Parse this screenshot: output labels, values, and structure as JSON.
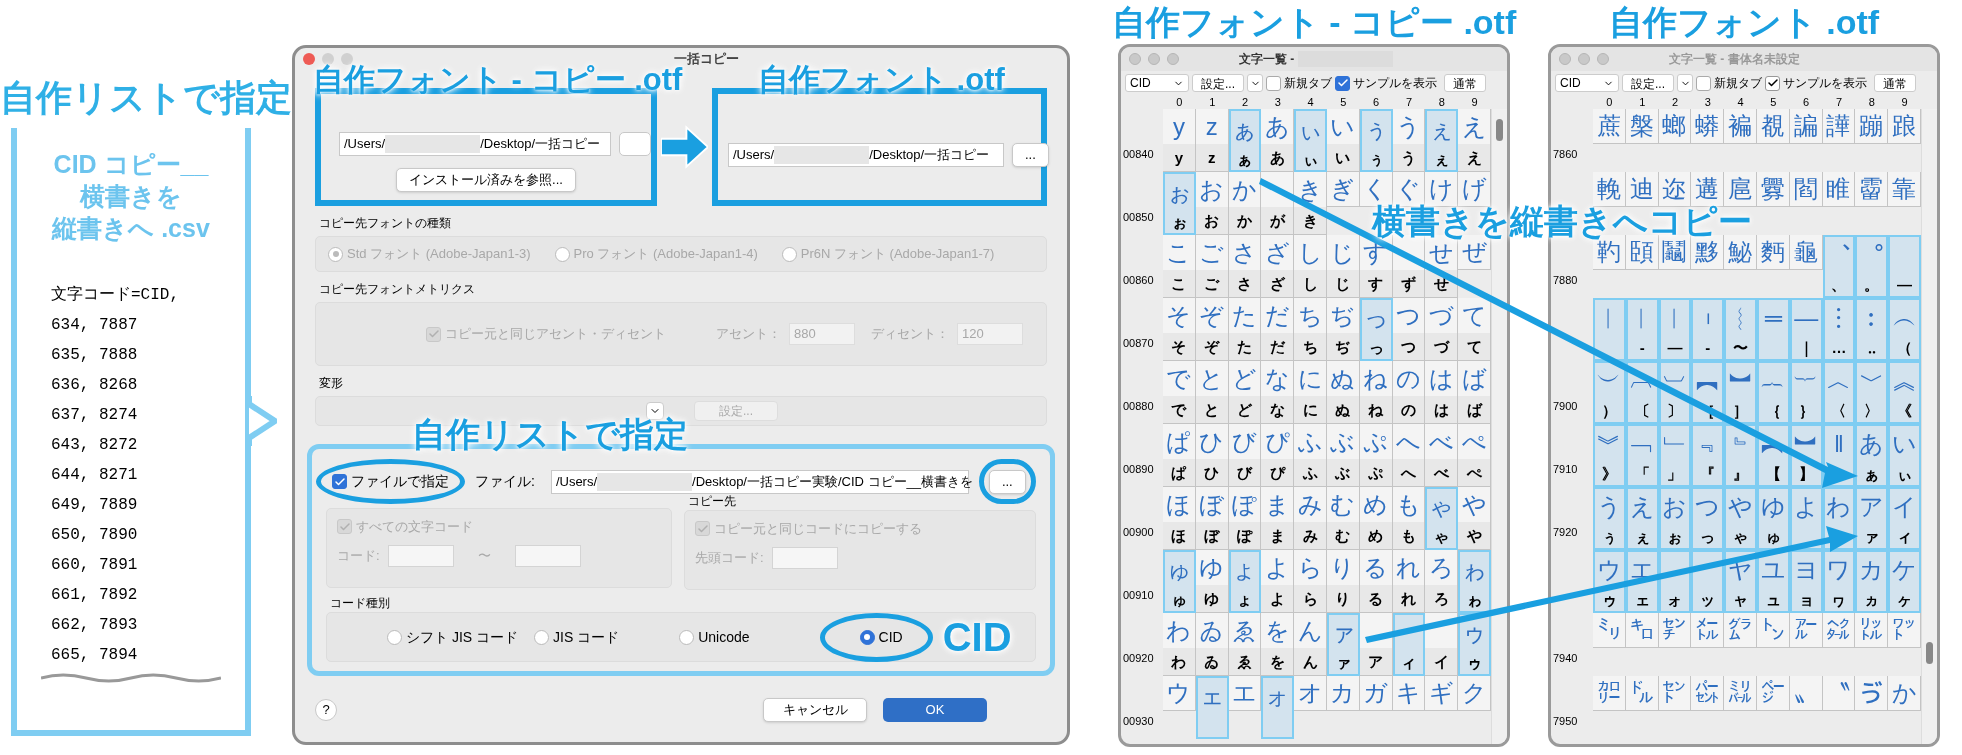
{
  "callout": {
    "title": "自作リストで指定",
    "file_name": [
      "CID コピー__",
      "横書きを",
      "縦書きへ .csv"
    ],
    "lines": [
      "文字コード=CID,",
      "634, 7887",
      "635, 7888",
      "636, 8268",
      "637, 8274",
      "643, 8272",
      "644, 8271",
      "649, 7889",
      "650, 7890",
      "660, 7891",
      "661, 7892",
      "662, 7893",
      "665, 7894"
    ]
  },
  "dialog": {
    "title": "一括コピー",
    "source": {
      "annotation": "自作フォント - コピー .otf",
      "path_start": "/Users/",
      "path_end": "/Desktop/一括コピー",
      "install_button": "インストール済みを参照..."
    },
    "destination": {
      "annotation": "自作フォント .otf",
      "path_start": "/Users/",
      "path_end": "/Desktop/一括コピー",
      "browse_button": "..."
    },
    "font_type": {
      "label": "コピー先フォントの種類",
      "disabled": true,
      "options": [
        {
          "label": "Std フォント (Adobe-Japan1-3)",
          "selected": true
        },
        {
          "label": "Pro フォント (Adobe-Japan1-4)",
          "selected": false
        },
        {
          "label": "Pr6N フォント (Adobe-Japan1-7)",
          "selected": false
        }
      ]
    },
    "metrics": {
      "label": "コピー先フォントメトリクス",
      "same_checkbox": {
        "label": "コピー元と同じアセント・ディセント",
        "checked": true,
        "disabled": true
      },
      "ascent_label": "アセント：",
      "ascent": "880",
      "descent_label": "ディセント：",
      "descent": "120"
    },
    "transform": {
      "label": "変形",
      "settings_button": "設定...",
      "disabled": true
    },
    "list": {
      "annotation": "自作リストで指定",
      "file_checkbox": {
        "label": "ファイルで指定",
        "checked": true
      },
      "file_label": "ファイル:",
      "path_start": "/Users/",
      "path_end": "/Desktop/一括コピー実験/CID コピー__横書きを",
      "browse_button": "...",
      "source": {
        "all_codes": {
          "label": "すべての文字コード",
          "checked": true,
          "disabled": true
        },
        "code_label": "コード:",
        "range_sep": "〜"
      },
      "destination": {
        "label": "コピー先",
        "same_code": {
          "label": "コピー元と同じコードにコピーする",
          "checked": true,
          "disabled": true
        },
        "start_label": "先頭コード:"
      },
      "code_type": {
        "label": "コード種別",
        "annotation": "CID",
        "options": [
          {
            "label": "シフト JIS コード",
            "selected": false
          },
          {
            "label": "JIS コード",
            "selected": false
          },
          {
            "label": "Unicode",
            "selected": false
          },
          {
            "label": "CID",
            "selected": true
          }
        ]
      }
    },
    "help_button": "?",
    "cancel_button": "キャンセル",
    "ok_button": "OK"
  },
  "copy_label": "横書きを縦書きへコピー",
  "windows": [
    {
      "heading": "自作フォント - コピー .otf",
      "title": "文字一覧 -",
      "title_redacted": true,
      "active": true,
      "toolbar": {
        "mode": "CID",
        "settings": "設定...",
        "new_tab": {
          "label": "新規タブ",
          "checked": false
        },
        "show_sample": {
          "label": "サンプルを表示",
          "checked": true
        },
        "view": "通常"
      },
      "columns": [
        "0",
        "1",
        "2",
        "3",
        "4",
        "5",
        "6",
        "7",
        "8",
        "9"
      ],
      "rows": [
        {
          "label": "00840",
          "cells": [
            {
              "glyph": "y",
              "sample": "y",
              "highlighted": false
            },
            {
              "glyph": "z",
              "sample": "z",
              "highlighted": false
            },
            {
              "glyph": "ぁ",
              "sample": "ぁ",
              "highlighted": true
            },
            {
              "glyph": "あ",
              "sample": "あ",
              "highlighted": false
            },
            {
              "glyph": "ぃ",
              "sample": "ぃ",
              "highlighted": true
            },
            {
              "glyph": "い",
              "sample": "い",
              "highlighted": false
            },
            {
              "glyph": "ぅ",
              "sample": "ぅ",
              "highlighted": true
            },
            {
              "glyph": "う",
              "sample": "う",
              "highlighted": false
            },
            {
              "glyph": "ぇ",
              "sample": "ぇ",
              "highlighted": true
            },
            {
              "glyph": "え",
              "sample": "え",
              "highlighted": false
            }
          ]
        },
        {
          "label": "00850",
          "cells": [
            {
              "glyph": "ぉ",
              "sample": "ぉ",
              "highlighted": true
            },
            {
              "glyph": "お",
              "sample": "お",
              "highlighted": false
            },
            {
              "glyph": "か",
              "sample": "か",
              "highlighted": false
            },
            {
              "sample": "が",
              "highlighted": false
            },
            {
              "glyph": "き",
              "sample": "き",
              "highlighted": false
            },
            {
              "glyph": "ぎ",
              "highlighted": false
            },
            {
              "glyph": "く",
              "highlighted": false
            },
            {
              "glyph": "ぐ",
              "highlighted": false
            },
            {
              "glyph": "け",
              "highlighted": false
            },
            {
              "glyph": "げ",
              "highlighted": false
            }
          ]
        },
        {
          "label": "00860",
          "cells": [
            {
              "glyph": "こ",
              "sample": "こ",
              "highlighted": false
            },
            {
              "glyph": "ご",
              "sample": "ご",
              "highlighted": false
            },
            {
              "glyph": "さ",
              "sample": "さ",
              "highlighted": false
            },
            {
              "glyph": "ざ",
              "sample": "ざ",
              "highlighted": false
            },
            {
              "glyph": "し",
              "sample": "し",
              "highlighted": false
            },
            {
              "glyph": "じ",
              "sample": "じ",
              "highlighted": false
            },
            {
              "glyph": "す",
              "sample": "す",
              "highlighted": false
            },
            {
              "sample": "ず",
              "highlighted": false
            },
            {
              "glyph": "せ",
              "sample": "せ",
              "highlighted": false
            },
            {
              "glyph": "ぜ",
              "highlighted": false
            }
          ]
        },
        {
          "label": "00870",
          "cells": [
            {
              "glyph": "そ",
              "sample": "そ",
              "highlighted": false
            },
            {
              "glyph": "ぞ",
              "sample": "ぞ",
              "highlighted": false
            },
            {
              "glyph": "た",
              "sample": "た",
              "highlighted": false
            },
            {
              "glyph": "だ",
              "sample": "だ",
              "highlighted": false
            },
            {
              "glyph": "ち",
              "sample": "ち",
              "highlighted": false
            },
            {
              "glyph": "ぢ",
              "sample": "ぢ",
              "highlighted": false
            },
            {
              "glyph": "っ",
              "sample": "っ",
              "highlighted": true
            },
            {
              "glyph": "つ",
              "sample": "つ",
              "highlighted": false
            },
            {
              "glyph": "づ",
              "sample": "づ",
              "highlighted": false
            },
            {
              "glyph": "て",
              "sample": "て",
              "highlighted": false
            }
          ]
        },
        {
          "label": "00880",
          "cells": [
            {
              "glyph": "で",
              "sample": "で",
              "highlighted": false
            },
            {
              "glyph": "と",
              "sample": "と",
              "highlighted": false
            },
            {
              "glyph": "ど",
              "sample": "ど",
              "highlighted": false
            },
            {
              "glyph": "な",
              "sample": "な",
              "highlighted": false
            },
            {
              "glyph": "に",
              "sample": "に",
              "highlighted": false
            },
            {
              "glyph": "ぬ",
              "sample": "ぬ",
              "highlighted": false
            },
            {
              "glyph": "ね",
              "sample": "ね",
              "highlighted": false
            },
            {
              "glyph": "の",
              "sample": "の",
              "highlighted": false
            },
            {
              "glyph": "は",
              "sample": "は",
              "highlighted": false
            },
            {
              "glyph": "ば",
              "sample": "ば",
              "highlighted": false
            }
          ]
        },
        {
          "label": "00890",
          "cells": [
            {
              "glyph": "ぱ",
              "sample": "ぱ",
              "highlighted": false
            },
            {
              "glyph": "ひ",
              "sample": "ひ",
              "highlighted": false
            },
            {
              "glyph": "び",
              "sample": "び",
              "highlighted": false
            },
            {
              "glyph": "ぴ",
              "sample": "ぴ",
              "highlighted": false
            },
            {
              "glyph": "ふ",
              "sample": "ふ",
              "highlighted": false
            },
            {
              "glyph": "ぶ",
              "sample": "ぶ",
              "highlighted": false
            },
            {
              "glyph": "ぷ",
              "sample": "ぷ",
              "highlighted": false
            },
            {
              "glyph": "へ",
              "sample": "へ",
              "highlighted": false
            },
            {
              "glyph": "べ",
              "sample": "べ",
              "highlighted": false
            },
            {
              "glyph": "ぺ",
              "sample": "ぺ",
              "highlighted": false
            }
          ]
        },
        {
          "label": "00900",
          "cells": [
            {
              "glyph": "ほ",
              "sample": "ほ",
              "highlighted": false
            },
            {
              "glyph": "ぼ",
              "sample": "ぼ",
              "highlighted": false
            },
            {
              "glyph": "ぽ",
              "sample": "ぽ",
              "highlighted": false
            },
            {
              "glyph": "ま",
              "sample": "ま",
              "highlighted": false
            },
            {
              "glyph": "み",
              "sample": "み",
              "highlighted": false
            },
            {
              "glyph": "む",
              "sample": "む",
              "highlighted": false
            },
            {
              "glyph": "め",
              "sample": "め",
              "highlighted": false
            },
            {
              "glyph": "も",
              "sample": "も",
              "highlighted": false
            },
            {
              "glyph": "ゃ",
              "sample": "ゃ",
              "highlighted": true
            },
            {
              "glyph": "や",
              "sample": "や",
              "highlighted": false
            }
          ]
        },
        {
          "label": "00910",
          "cells": [
            {
              "glyph": "ゅ",
              "sample": "ゅ",
              "highlighted": true
            },
            {
              "glyph": "ゆ",
              "sample": "ゆ",
              "highlighted": false
            },
            {
              "glyph": "ょ",
              "sample": "ょ",
              "highlighted": true
            },
            {
              "glyph": "よ",
              "sample": "よ",
              "highlighted": false
            },
            {
              "glyph": "ら",
              "sample": "ら",
              "highlighted": false
            },
            {
              "glyph": "り",
              "sample": "り",
              "highlighted": false
            },
            {
              "glyph": "る",
              "sample": "る",
              "highlighted": false
            },
            {
              "glyph": "れ",
              "sample": "れ",
              "highlighted": false
            },
            {
              "glyph": "ろ",
              "sample": "ろ",
              "highlighted": false
            },
            {
              "glyph": "ゎ",
              "sample": "ゎ",
              "highlighted": true
            }
          ]
        },
        {
          "label": "00920",
          "cells": [
            {
              "glyph": "わ",
              "sample": "わ",
              "highlighted": false
            },
            {
              "glyph": "ゐ",
              "sample": "ゐ",
              "highlighted": false
            },
            {
              "glyph": "ゑ",
              "sample": "ゑ",
              "highlighted": false
            },
            {
              "glyph": "を",
              "sample": "を",
              "highlighted": false
            },
            {
              "glyph": "ん",
              "sample": "ん",
              "highlighted": false
            },
            {
              "glyph": "ァ",
              "sample": "ァ",
              "highlighted": true
            },
            {
              "sample": "ア",
              "highlighted": false
            },
            {
              "sample": "ィ",
              "highlighted": true
            },
            {
              "sample": "イ",
              "highlighted": false
            },
            {
              "glyph": "ゥ",
              "sample": "ゥ",
              "highlighted": true
            }
          ]
        },
        {
          "label": "00930",
          "cells": [
            {
              "glyph": "ウ",
              "highlighted": false
            },
            {
              "glyph": "ェ",
              "highlighted": true
            },
            {
              "glyph": "エ",
              "highlighted": false
            },
            {
              "glyph": "ォ",
              "highlighted": true
            },
            {
              "glyph": "オ",
              "highlighted": false
            },
            {
              "glyph": "カ",
              "highlighted": false
            },
            {
              "glyph": "ガ",
              "highlighted": false
            },
            {
              "glyph": "キ",
              "highlighted": false
            },
            {
              "glyph": "ギ",
              "highlighted": false
            },
            {
              "glyph": "ク",
              "highlighted": false
            }
          ]
        }
      ]
    },
    {
      "heading": "自作フォント .otf",
      "title": "文字一覧 - 書体名未設定",
      "title_redacted": false,
      "active": false,
      "toolbar": {
        "mode": "CID",
        "settings": "設定...",
        "new_tab": {
          "label": "新規タブ",
          "checked": false
        },
        "show_sample": {
          "label": "サンプルを表示",
          "checked": true
        },
        "view": "通常"
      },
      "columns": [
        "0",
        "1",
        "2",
        "3",
        "4",
        "5",
        "6",
        "7",
        "8",
        "9"
      ],
      "rows": [
        {
          "label": "7860",
          "cells": [
            {
              "glyph": "蔗",
              "highlighted": false
            },
            {
              "glyph": "槃",
              "highlighted": false
            },
            {
              "glyph": "螂",
              "highlighted": false
            },
            {
              "glyph": "蟒",
              "highlighted": false
            },
            {
              "glyph": "褊",
              "highlighted": false
            },
            {
              "glyph": "覩",
              "highlighted": false
            },
            {
              "glyph": "諞",
              "highlighted": false
            },
            {
              "glyph": "譁",
              "highlighted": false
            },
            {
              "glyph": "蹦",
              "highlighted": false
            },
            {
              "glyph": "踉",
              "highlighted": false
            }
          ]
        },
        {
          "cells": [
            {
              "glyph": "輓",
              "highlighted": false
            },
            {
              "glyph": "迪",
              "highlighted": false
            },
            {
              "glyph": "迩",
              "highlighted": false
            },
            {
              "glyph": "遘",
              "highlighted": false
            },
            {
              "glyph": "扈",
              "highlighted": false
            },
            {
              "glyph": "釁",
              "highlighted": false
            },
            {
              "glyph": "閻",
              "highlighted": false
            },
            {
              "glyph": "睢",
              "highlighted": false
            },
            {
              "glyph": "霤",
              "highlighted": false
            },
            {
              "glyph": "靠",
              "highlighted": false
            }
          ]
        },
        {
          "label": "7880",
          "cells": [
            {
              "glyph": "靮",
              "highlighted": false
            },
            {
              "glyph": "頣",
              "highlighted": false
            },
            {
              "glyph": "鬮",
              "highlighted": false
            },
            {
              "glyph": "黟",
              "highlighted": false
            },
            {
              "glyph": "鮅",
              "highlighted": false
            },
            {
              "glyph": "麪",
              "highlighted": false
            },
            {
              "glyph": "龜",
              "highlighted": false
            },
            {
              "glyph": "︑",
              "sample": "、",
              "highlighted": true
            },
            {
              "glyph": "︒",
              "sample": "。",
              "highlighted": true
            },
            {
              "sample": "—",
              "highlighted": true
            }
          ]
        },
        {
          "cells": [
            {
              "glyph": "︱",
              "highlighted": true
            },
            {
              "glyph": "︱",
              "sample": "‐",
              "highlighted": true
            },
            {
              "glyph": "︱",
              "sample": "—",
              "highlighted": true
            },
            {
              "glyph": "︲",
              "sample": "‐",
              "highlighted": true
            },
            {
              "glyph": "︴",
              "sample": "〜",
              "highlighted": true
            },
            {
              "glyph": "═",
              "highlighted": true
            },
            {
              "glyph": "―",
              "sample": "｜",
              "highlighted": true
            },
            {
              "glyph": "︙",
              "sample": "…",
              "highlighted": true
            },
            {
              "glyph": "︰",
              "sample": "‥",
              "highlighted": true
            },
            {
              "glyph": "︵",
              "sample": "（",
              "highlighted": true
            }
          ]
        },
        {
          "label": "7900",
          "cells": [
            {
              "glyph": "︶",
              "sample": "）",
              "highlighted": true
            },
            {
              "glyph": "︹",
              "sample": "〔",
              "highlighted": true
            },
            {
              "glyph": "︺",
              "sample": "〕",
              "highlighted": true
            },
            {
              "glyph": "︻",
              "sample": "［",
              "highlighted": true
            },
            {
              "glyph": "︼",
              "sample": "］",
              "highlighted": true
            },
            {
              "glyph": "︷",
              "sample": "｛",
              "highlighted": true
            },
            {
              "glyph": "︸",
              "sample": "｝",
              "highlighted": true
            },
            {
              "glyph": "︿",
              "sample": "〈",
              "highlighted": true
            },
            {
              "glyph": "﹀",
              "sample": "〉",
              "highlighted": true
            },
            {
              "glyph": "︽",
              "sample": "《",
              "highlighted": true
            }
          ]
        },
        {
          "label": "7910",
          "cells": [
            {
              "glyph": "︾",
              "sample": "》",
              "highlighted": true
            },
            {
              "glyph": "﹁",
              "sample": "「",
              "highlighted": true
            },
            {
              "glyph": "﹂",
              "sample": "」",
              "highlighted": true
            },
            {
              "glyph": "﹃",
              "sample": "『",
              "highlighted": true
            },
            {
              "glyph": "﹄",
              "sample": "』",
              "highlighted": true
            },
            {
              "glyph": "︻",
              "sample": "【",
              "highlighted": true
            },
            {
              "glyph": "︼",
              "sample": "】",
              "highlighted": true
            },
            {
              "glyph": "‖",
              "highlighted": true
            },
            {
              "glyph": "あ",
              "sample": "ぁ",
              "highlighted": true
            },
            {
              "glyph": "い",
              "sample": "ぃ",
              "highlighted": true
            }
          ]
        },
        {
          "label": "7920",
          "cells": [
            {
              "glyph": "う",
              "sample": "ぅ",
              "highlighted": true
            },
            {
              "glyph": "え",
              "sample": "ぇ",
              "highlighted": true
            },
            {
              "glyph": "お",
              "sample": "ぉ",
              "highlighted": true
            },
            {
              "glyph": "つ",
              "sample": "っ",
              "highlighted": true
            },
            {
              "glyph": "や",
              "sample": "ゃ",
              "highlighted": true
            },
            {
              "glyph": "ゆ",
              "sample": "ゅ",
              "highlighted": true
            },
            {
              "glyph": "よ",
              "highlighted": true
            },
            {
              "glyph": "わ",
              "highlighted": true
            },
            {
              "glyph": "ア",
              "sample": "ァ",
              "highlighted": true
            },
            {
              "glyph": "イ",
              "sample": "ィ",
              "highlighted": true
            }
          ]
        },
        {
          "cells": [
            {
              "glyph": "ウ",
              "sample": "ゥ",
              "highlighted": true
            },
            {
              "glyph": "エ",
              "sample": "ェ",
              "highlighted": true
            },
            {
              "sample": "ォ",
              "highlighted": true
            },
            {
              "sample": "ッ",
              "highlighted": true
            },
            {
              "glyph": "ヤ",
              "sample": "ャ",
              "highlighted": true
            },
            {
              "glyph": "ユ",
              "sample": "ュ",
              "highlighted": true
            },
            {
              "glyph": "ヨ",
              "sample": "ョ",
              "highlighted": true
            },
            {
              "glyph": "ワ",
              "sample": "ヮ",
              "highlighted": true
            },
            {
              "glyph": "カ",
              "sample": "ヵ",
              "highlighted": true
            },
            {
              "glyph": "ケ",
              "sample": "ヶ",
              "highlighted": true
            }
          ]
        },
        {
          "label": "7940",
          "cells": [
            {
              "glyph": "㍉",
              "highlighted": false
            },
            {
              "glyph": "㌔",
              "highlighted": false
            },
            {
              "glyph": "㌢",
              "highlighted": false
            },
            {
              "glyph": "㍍",
              "highlighted": false
            },
            {
              "glyph": "㌘",
              "highlighted": false
            },
            {
              "glyph": "㌧",
              "highlighted": false
            },
            {
              "glyph": "㌃",
              "highlighted": false
            },
            {
              "glyph": "㌶",
              "highlighted": false
            },
            {
              "glyph": "㍑",
              "highlighted": false
            },
            {
              "glyph": "㍗",
              "highlighted": false
            }
          ]
        },
        {
          "label": "7950",
          "cells": [
            {
              "glyph": "㌍",
              "highlighted": false
            },
            {
              "glyph": "㌦",
              "highlighted": false
            },
            {
              "glyph": "㌣",
              "highlighted": false
            },
            {
              "glyph": "㌫",
              "highlighted": false
            },
            {
              "glyph": "㍊",
              "highlighted": false
            },
            {
              "glyph": "㌻",
              "highlighted": false
            },
            {
              "glyph": "〟",
              "highlighted": false
            },
            {
              "glyph": "〝",
              "highlighted": false
            },
            {
              "glyph": "ゔ",
              "highlighted": false
            },
            {
              "glyph": "か",
              "highlighted": false
            }
          ]
        }
      ]
    }
  ]
}
